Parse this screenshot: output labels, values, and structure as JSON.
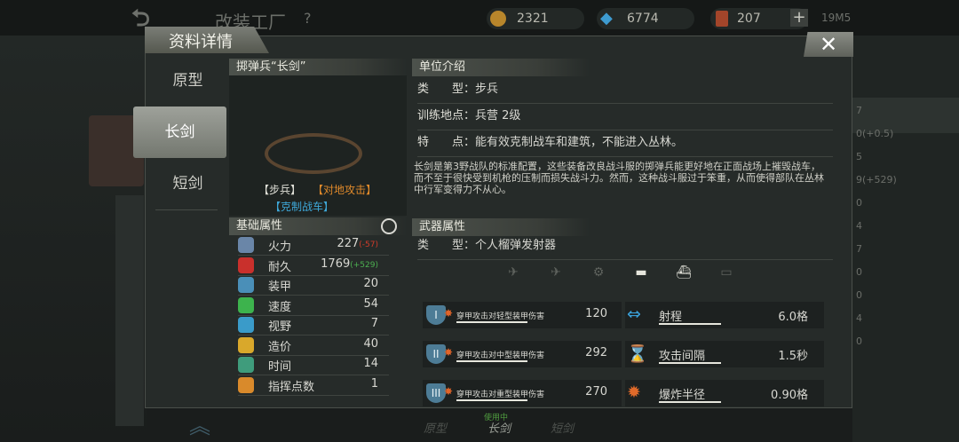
{
  "top_bar": {
    "title": "改装工厂",
    "help": "?",
    "gold": "2321",
    "diamond": "6774",
    "card": "207",
    "plus": "+",
    "time": "19M5"
  },
  "panel": {
    "title": "资料详情",
    "close": "✕",
    "tabs": [
      "原型",
      "长剑",
      "短剑"
    ],
    "active_tab": "长剑"
  },
  "unit": {
    "name": "掷弹兵“长剑”",
    "tag_type": "【步兵】",
    "tag_attack": "【对地攻击】",
    "tag_counter": "【克制战车】"
  },
  "base_stats": {
    "header": "基础属性",
    "rows": [
      {
        "label": "火力",
        "value": "227",
        "bonus": "(-57)",
        "bonus_color": "#d23b2a",
        "icon": "firepower-icon",
        "icon_color": "#6a86a8"
      },
      {
        "label": "耐久",
        "value": "1769",
        "bonus": "(+529)",
        "bonus_color": "#4caf50",
        "icon": "heart-icon",
        "icon_color": "#c9302c"
      },
      {
        "label": "装甲",
        "value": "20",
        "bonus": "",
        "bonus_color": "",
        "icon": "armor-icon",
        "icon_color": "#4a8fb8"
      },
      {
        "label": "速度",
        "value": "54",
        "bonus": "",
        "bonus_color": "",
        "icon": "speed-icon",
        "icon_color": "#3db34d"
      },
      {
        "label": "视野",
        "value": "7",
        "bonus": "",
        "bonus_color": "",
        "icon": "eye-icon",
        "icon_color": "#3a9bc9"
      },
      {
        "label": "造价",
        "value": "40",
        "bonus": "",
        "bonus_color": "",
        "icon": "cost-icon",
        "icon_color": "#d9a82b"
      },
      {
        "label": "时间",
        "value": "14",
        "bonus": "",
        "bonus_color": "",
        "icon": "time-icon",
        "icon_color": "#3f9c7c"
      },
      {
        "label": "指挥点数",
        "value": "1",
        "bonus": "",
        "bonus_color": "",
        "icon": "command-icon",
        "icon_color": "#d98a2b"
      }
    ]
  },
  "unit_intro": {
    "header": "单位介绍",
    "rows": [
      {
        "key": "类　　型：",
        "value": "步兵"
      },
      {
        "key": "训练地点：",
        "value": "兵营 2级"
      },
      {
        "key": "特　　点：",
        "value": "能有效克制战车和建筑，不能进入丛林。"
      }
    ],
    "description": "长剑是第3野战队的标准配置，这些装备改良战斗服的掷弹兵能更好地在正面战场上摧毁战车，而不至于很快受到机枪的压制而损失战斗力。然而，这种战斗服过于笨重，从而使得部队在丛林中行军变得力不从心。"
  },
  "weapon": {
    "header": "武器属性",
    "type_key": "类　　型：",
    "type_value": "个人榴弹发射器",
    "targets": [
      {
        "icon": "plane-icon",
        "active": false
      },
      {
        "icon": "bomber-icon",
        "active": false
      },
      {
        "icon": "helicopter-icon",
        "active": false
      },
      {
        "icon": "tank-icon",
        "active": true
      },
      {
        "icon": "ship-icon",
        "active": true
      },
      {
        "icon": "submarine-icon",
        "active": false
      }
    ],
    "damage": [
      {
        "roman": "I",
        "label": "穿甲攻击对轻型装甲伤害",
        "value": "120"
      },
      {
        "roman": "II",
        "label": "穿甲攻击对中型装甲伤害",
        "value": "292"
      },
      {
        "roman": "III",
        "label": "穿甲攻击对重型装甲伤害",
        "value": "270"
      }
    ],
    "props": [
      {
        "label": "射程",
        "value": "6.0格",
        "icon": "range-icon",
        "color": "#3aa0d8"
      },
      {
        "label": "攻击间隔",
        "value": "1.5秒",
        "icon": "hourglass-icon",
        "color": "#4a90c9"
      },
      {
        "label": "爆炸半径",
        "value": "0.90格",
        "icon": "explosion-icon",
        "color": "#e06a2a"
      }
    ]
  },
  "bottom": {
    "in_use": "使用中",
    "tabs": [
      "原型",
      "长剑",
      "短剑"
    ]
  },
  "right_edge": [
    "7",
    "0(+0.5)",
    "5",
    "9(+529)",
    "0",
    "4",
    "7",
    "0",
    "0",
    "4",
    "0"
  ]
}
